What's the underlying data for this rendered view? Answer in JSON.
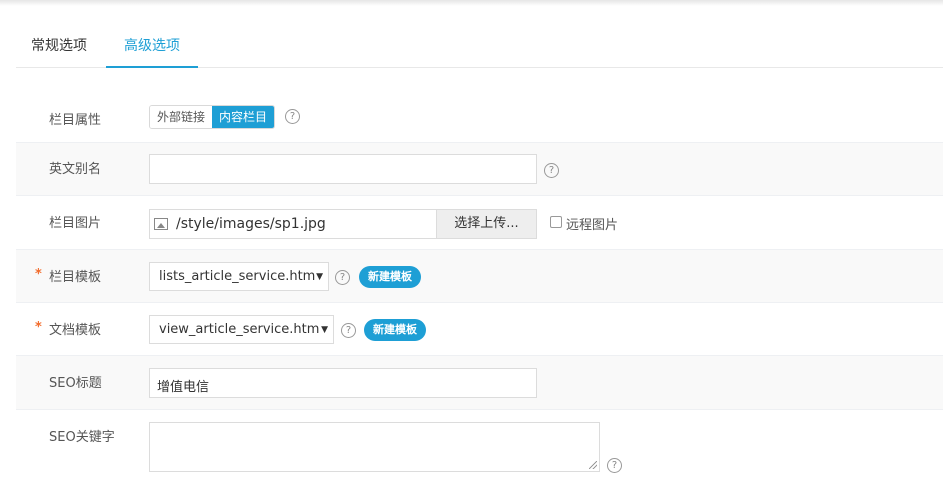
{
  "tabs": [
    {
      "label": "常规选项",
      "active": false
    },
    {
      "label": "高级选项",
      "active": true
    }
  ],
  "form": {
    "attr": {
      "label": "栏目属性",
      "options": [
        "外部链接",
        "内容栏目"
      ],
      "selected": "内容栏目"
    },
    "alias": {
      "label": "英文别名",
      "value": ""
    },
    "image": {
      "label": "栏目图片",
      "value": "/style/images/sp1.jpg",
      "upload_label": "选择上传...",
      "remote_label": "远程图片",
      "remote_checked": false
    },
    "column_template": {
      "label": "栏目模板",
      "required_mark": "*",
      "value": "lists_article_service.htm",
      "new_label": "新建模板"
    },
    "doc_template": {
      "label": "文档模板",
      "required_mark": "*",
      "value": "view_article_service.htm",
      "new_label": "新建模板"
    },
    "seo_title": {
      "label": "SEO标题",
      "value": "增值电信"
    },
    "seo_keywords": {
      "label": "SEO关键字",
      "value": ""
    }
  },
  "help_glyph": "?",
  "select_arrow": "▼",
  "colors": {
    "accent": "#1e9fd5",
    "required": "#f26b2b"
  }
}
